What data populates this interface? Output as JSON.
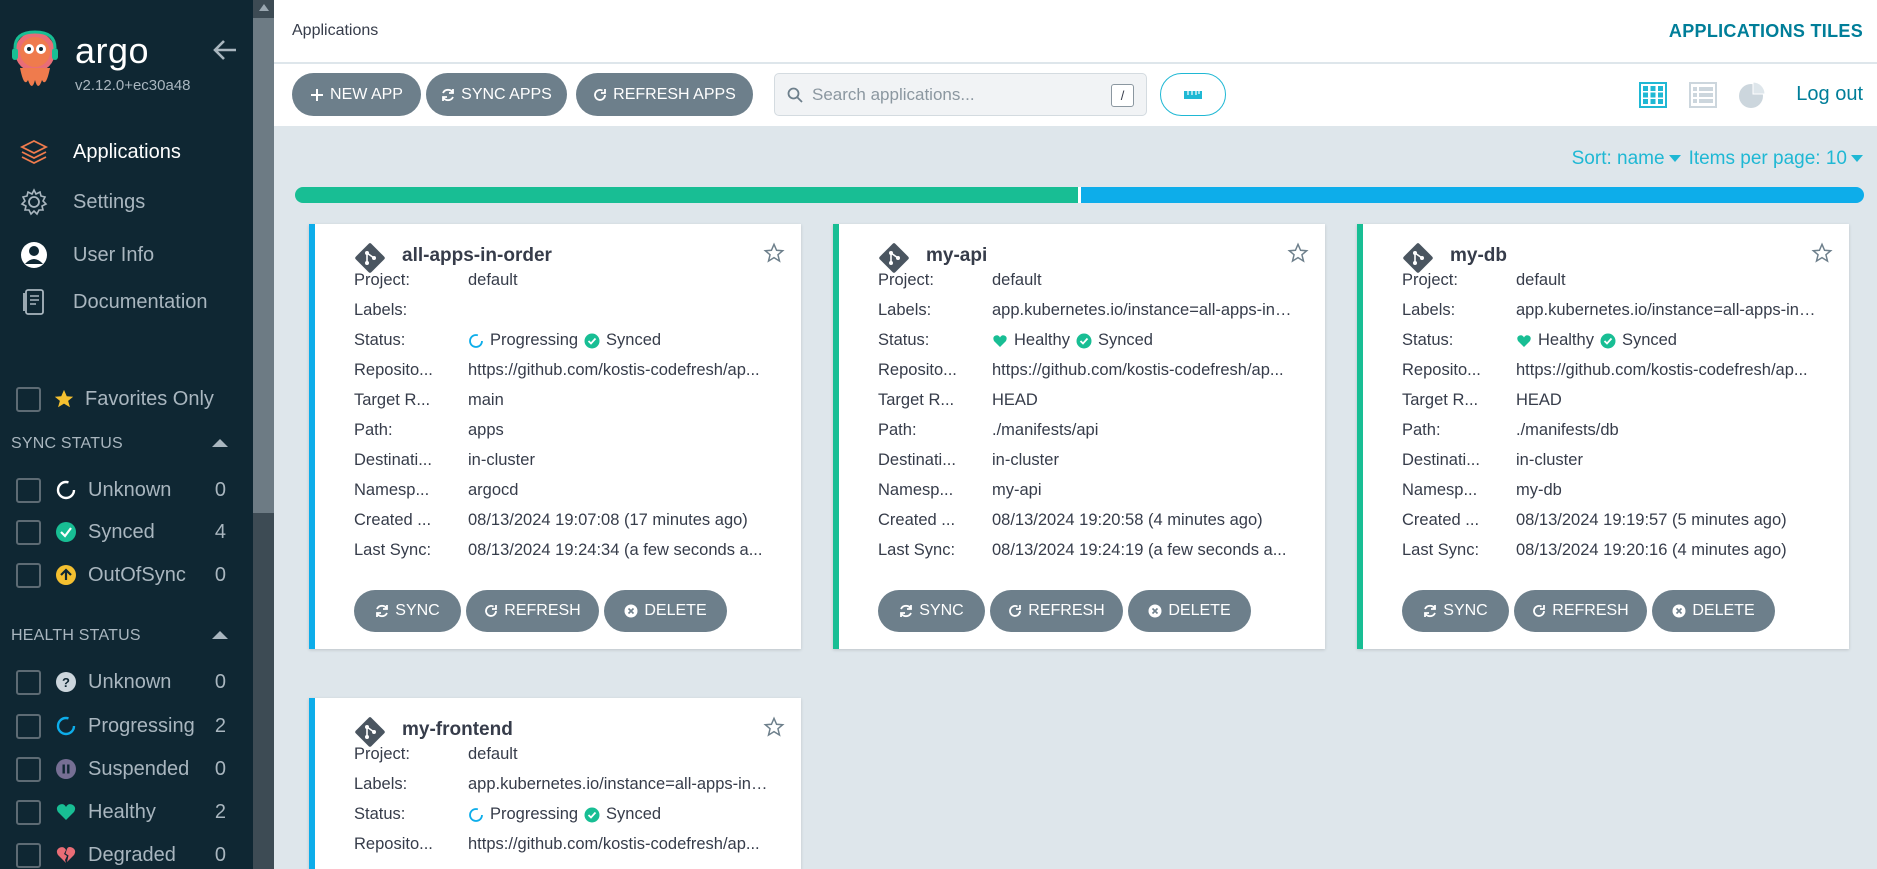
{
  "sidebar": {
    "brand": "argo",
    "version": "v2.12.0+ec30a48",
    "nav": [
      {
        "label": "Applications",
        "active": true
      },
      {
        "label": "Settings"
      },
      {
        "label": "User Info"
      },
      {
        "label": "Documentation"
      }
    ],
    "favorites_label": "Favorites Only",
    "sync_status": {
      "title": "SYNC STATUS",
      "items": [
        {
          "label": "Unknown",
          "count": "0"
        },
        {
          "label": "Synced",
          "count": "4"
        },
        {
          "label": "OutOfSync",
          "count": "0"
        }
      ]
    },
    "health_status": {
      "title": "HEALTH STATUS",
      "items": [
        {
          "label": "Unknown",
          "count": "0"
        },
        {
          "label": "Progressing",
          "count": "2"
        },
        {
          "label": "Suspended",
          "count": "0"
        },
        {
          "label": "Healthy",
          "count": "2"
        },
        {
          "label": "Degraded",
          "count": "0"
        }
      ]
    }
  },
  "topbar": {
    "breadcrumb": "Applications",
    "view_title": "APPLICATIONS TILES"
  },
  "toolbar": {
    "new_app": "NEW APP",
    "sync_apps": "SYNC APPS",
    "refresh_apps": "REFRESH APPS",
    "search_placeholder": "Search applications...",
    "search_shortcut": "/",
    "logout": "Log out"
  },
  "sort": {
    "sort_label": "Sort: name",
    "items_per_page": "Items per page: 10"
  },
  "status_bar": {
    "synced_fraction": 0.5,
    "colors": {
      "healthy": "#18be94",
      "progressing": "#0dadea"
    }
  },
  "card_labels": {
    "project": "Project:",
    "labels": "Labels:",
    "status": "Status:",
    "repository": "Reposito...",
    "target_revision": "Target R...",
    "path": "Path:",
    "destination": "Destinati...",
    "namespace": "Namesp...",
    "created": "Created ...",
    "last_sync": "Last Sync:",
    "sync_btn": "SYNC",
    "refresh_btn": "REFRESH",
    "delete_btn": "DELETE"
  },
  "apps": [
    {
      "name": "all-apps-in-order",
      "project": "default",
      "labels": "",
      "health": "Progressing",
      "sync": "Synced",
      "repository": "https://github.com/kostis-codefresh/ap...",
      "target_revision": "main",
      "path": "apps",
      "destination": "in-cluster",
      "namespace": "argocd",
      "created": "08/13/2024 19:07:08  (17 minutes ago)",
      "last_sync": "08/13/2024 19:24:34  (a few seconds a..."
    },
    {
      "name": "my-api",
      "project": "default",
      "labels": "app.kubernetes.io/instance=all-apps-in-...",
      "health": "Healthy",
      "sync": "Synced",
      "repository": "https://github.com/kostis-codefresh/ap...",
      "target_revision": "HEAD",
      "path": "./manifests/api",
      "destination": "in-cluster",
      "namespace": "my-api",
      "created": "08/13/2024 19:20:58  (4 minutes ago)",
      "last_sync": "08/13/2024 19:24:19  (a few seconds a..."
    },
    {
      "name": "my-db",
      "project": "default",
      "labels": "app.kubernetes.io/instance=all-apps-in-...",
      "health": "Healthy",
      "sync": "Synced",
      "repository": "https://github.com/kostis-codefresh/ap...",
      "target_revision": "HEAD",
      "path": "./manifests/db",
      "destination": "in-cluster",
      "namespace": "my-db",
      "created": "08/13/2024 19:19:57  (5 minutes ago)",
      "last_sync": "08/13/2024 19:20:16  (4 minutes ago)"
    },
    {
      "name": "my-frontend",
      "project": "default",
      "labels": "app.kubernetes.io/instance=all-apps-in-...",
      "health": "Progressing",
      "sync": "Synced",
      "repository": "https://github.com/kostis-codefresh/ap..."
    }
  ]
}
